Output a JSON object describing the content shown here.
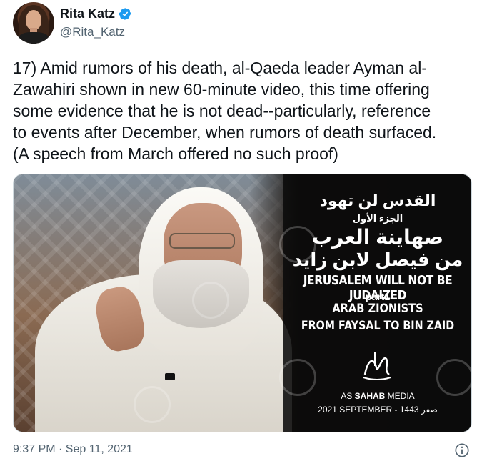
{
  "author": {
    "display_name": "Rita Katz",
    "handle": "@Rita_Katz",
    "verified_icon": "verified-badge-icon",
    "verified_color": "#1d9bf0"
  },
  "tweet": {
    "text": "17) Amid rumors of his death, al-Qaeda leader Ayman al-\nZawahiri shown in new 60-minute video, this time offering\nsome evidence that he is not dead--particularly, reference\nto events after December, when rumors of death surfaced.\n(A speech from March offered no such proof)",
    "timestamp": "9:37 PM · Sep 11, 2021",
    "info_icon": "info-icon"
  },
  "media": {
    "title_arabic": "القدس لن تهود",
    "part_arabic": "الجزء الأول",
    "subtitle_arabic_1": "صهاينة العرب",
    "subtitle_arabic_2": "من فيصل لابن زايد",
    "title_english": "JERUSALEM WILL NOT BE JUDAIZED",
    "part_english": "part1",
    "subtitle_english_1": "ARAB ZIONISTS",
    "subtitle_english_2": "FROM FAYSAL TO BIN ZAID",
    "brand_prefix": "AS ",
    "brand_bold": "SAHAB",
    "brand_suffix": " MEDIA",
    "date_line": "2021 SEPTEMBER - 1443 صفر"
  },
  "colors": {
    "text_primary": "#0f1419",
    "text_secondary": "#536471",
    "border": "#cfd9de"
  }
}
